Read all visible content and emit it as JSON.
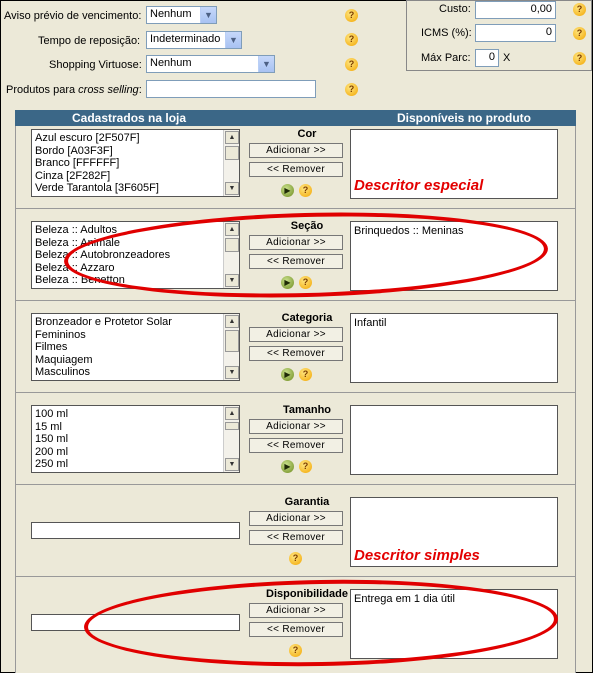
{
  "form": {
    "aviso_label": "Aviso prévio de vencimento:",
    "aviso_value": "Nenhum",
    "tempo_label": "Tempo de reposição:",
    "tempo_value": "Indeterminado",
    "shopping_label": "Shopping Virtuose:",
    "shopping_value": "Nenhum",
    "cross_label_prefix": "Produtos para ",
    "cross_label_em": "cross selling",
    "cross_label_suffix": ":",
    "cross_value": ""
  },
  "pricing": {
    "custo_label": "Custo:",
    "custo_value": "0,00",
    "icms_label": "ICMS (%):",
    "icms_value": "0",
    "maxparc_label": "Máx Parc:",
    "maxparc_value": "0",
    "maxparc_suffix": "X"
  },
  "table": {
    "col_left": "Cadastrados na loja",
    "col_right": "Disponíveis no produto",
    "add_label": "Adicionar >>",
    "remove_label": "<< Remover",
    "help_glyph": "?",
    "go_glyph": "▶"
  },
  "sections": [
    {
      "title": "Cor",
      "store_items": [
        "Azul escuro [2F507F]",
        "Bordo [A03F3F]",
        "Branco [FFFFFF]",
        "Cinza [2F282F]",
        "Verde Tarantola [3F605F]"
      ],
      "product_items": []
    },
    {
      "title": "Seção",
      "store_items": [
        "Beleza :: Adultos",
        "Beleza :: Animale",
        "Beleza :: Autobronzeadores",
        "Beleza :: Azzaro",
        "Beleza :: Benetton"
      ],
      "product_items": [
        "Brinquedos :: Meninas"
      ]
    },
    {
      "title": "Categoria",
      "store_items": [
        "Bronzeador e Protetor Solar",
        "Femininos",
        "Filmes",
        "Maquiagem",
        "Masculinos"
      ],
      "product_items": [
        "Infantil"
      ]
    },
    {
      "title": "Tamanho",
      "store_items": [
        "100 ml",
        "15 ml",
        "150 ml",
        "200 ml",
        "250 ml"
      ],
      "product_items": []
    },
    {
      "title": "Garantia",
      "store_value": "",
      "product_items": []
    },
    {
      "title": "Disponibilidade",
      "store_value": "",
      "product_items": [
        "Entrega em 1 dia útil"
      ]
    }
  ],
  "annotations": {
    "note_special": "Descritor especial",
    "note_simple": "Descritor simples"
  },
  "colors": {
    "header_bg": "#3B6787",
    "annotation_red": "#E30000"
  }
}
